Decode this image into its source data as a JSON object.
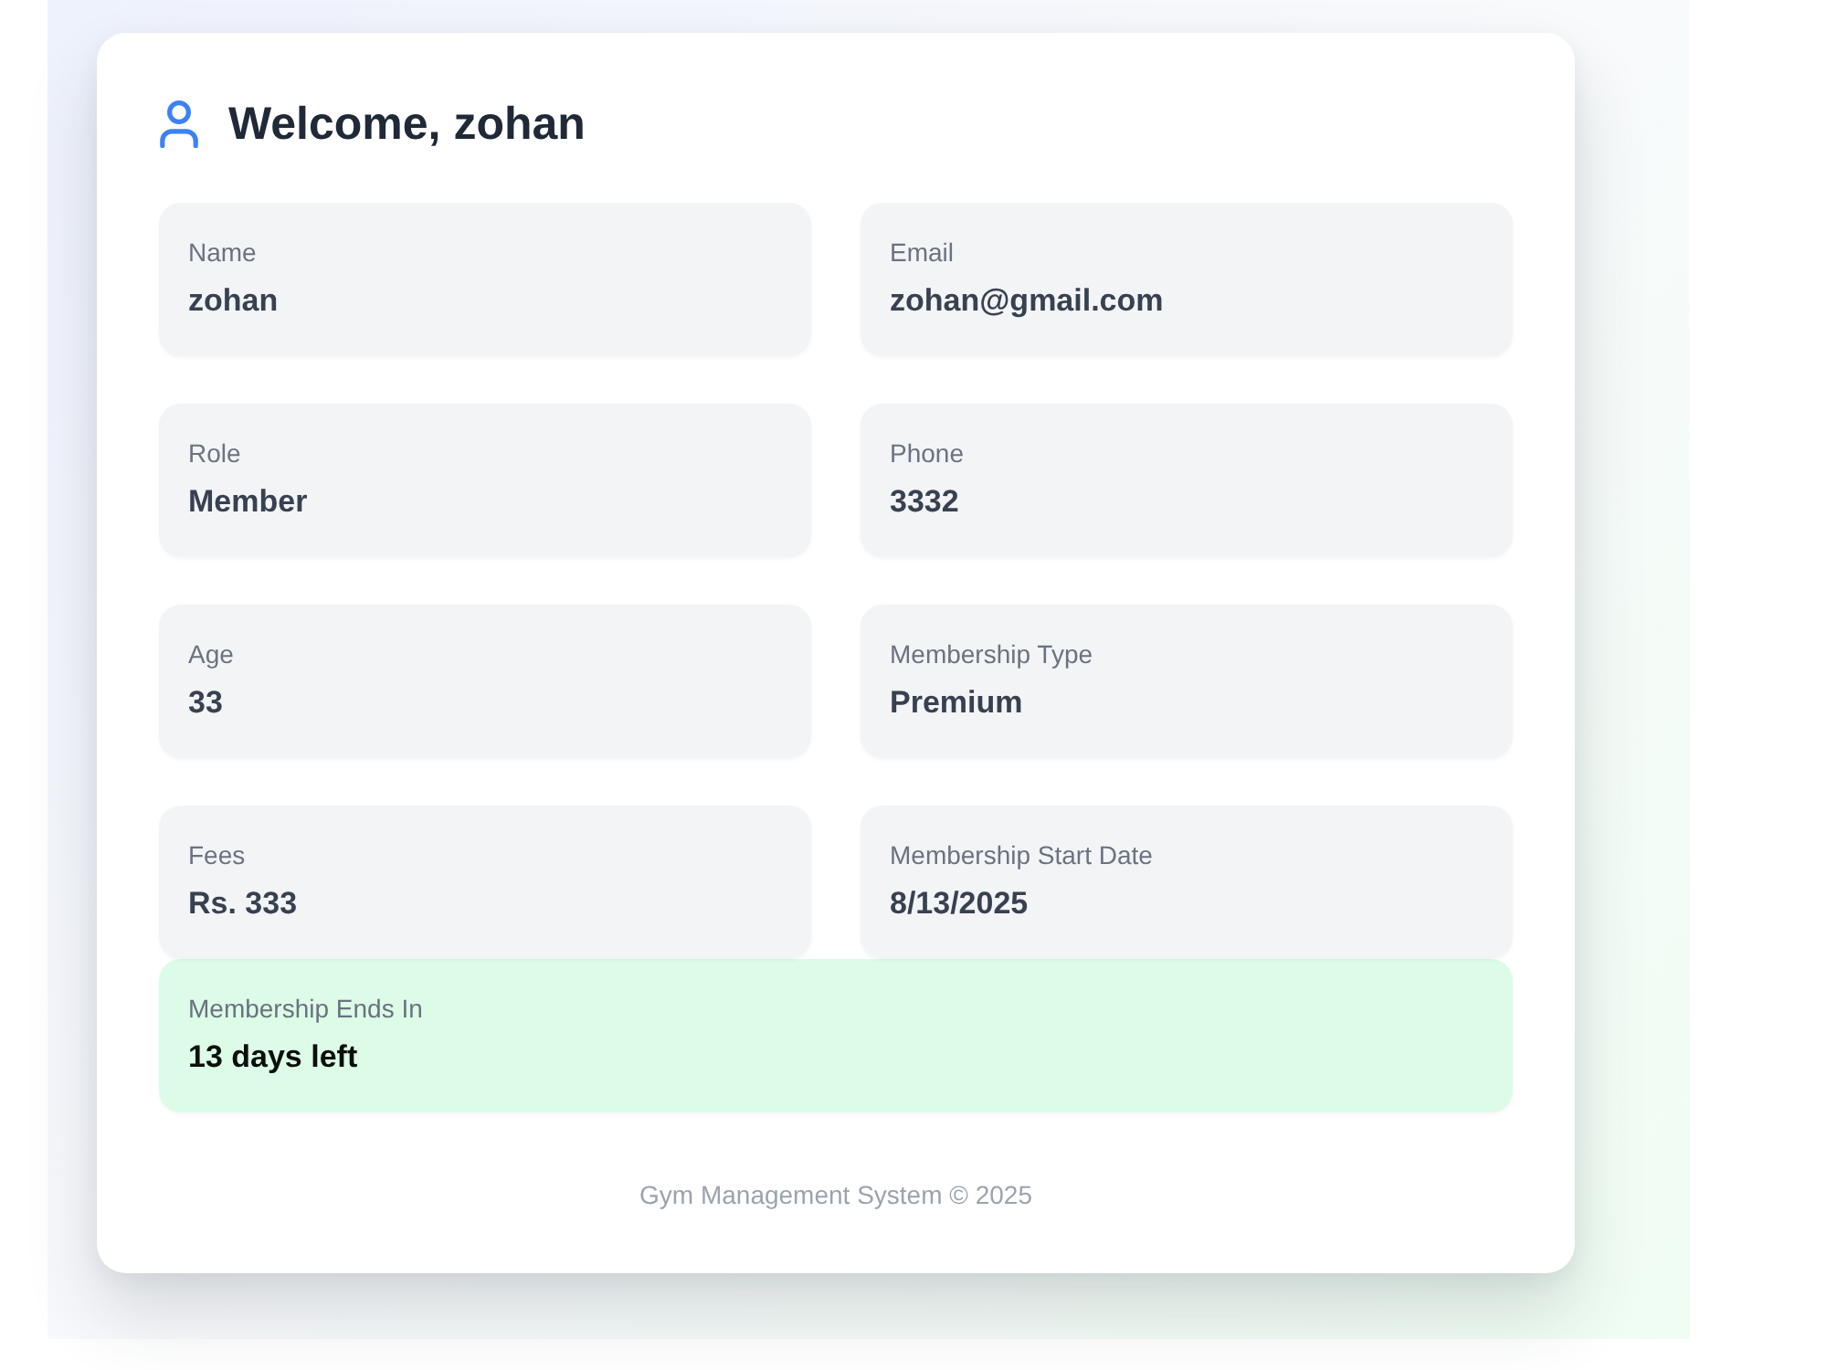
{
  "header": {
    "title": "Welcome, zohan"
  },
  "fields": [
    {
      "kind": "info",
      "label": "Name",
      "value": "zohan"
    },
    {
      "kind": "info",
      "label": "Email",
      "value": "zohan@gmail.com"
    },
    {
      "kind": "info",
      "label": "Role",
      "value": "Member"
    },
    {
      "kind": "info",
      "label": "Phone",
      "value": "3332"
    },
    {
      "kind": "info",
      "label": "Age",
      "value": "33"
    },
    {
      "kind": "info",
      "label": "Membership Type",
      "value": "Premium"
    },
    {
      "kind": "info",
      "label": "Fees",
      "value": "Rs. 333"
    },
    {
      "kind": "info",
      "label": "Membership Start Date",
      "value": "8/13/2025"
    },
    {
      "kind": "highlight",
      "label": "Membership Ends In",
      "value": "13 days left"
    }
  ],
  "footer": {
    "text": "Gym Management System © 2025"
  }
}
